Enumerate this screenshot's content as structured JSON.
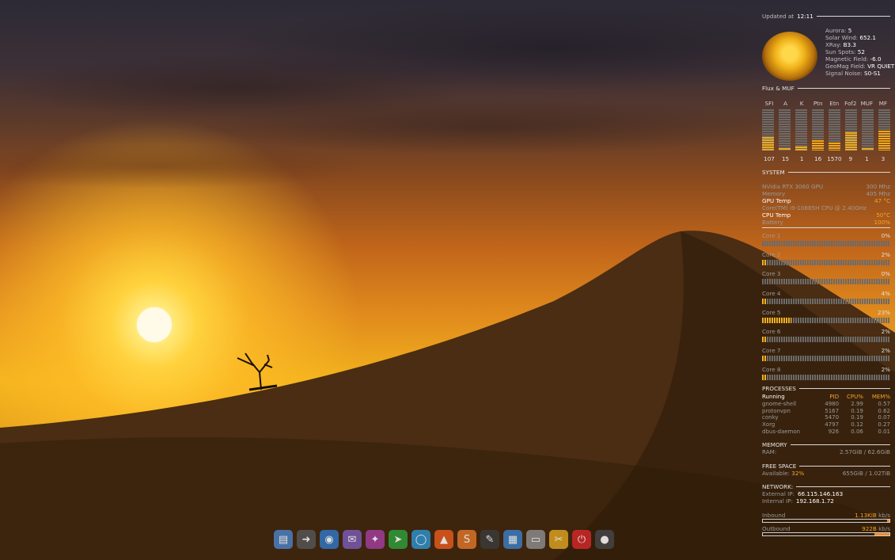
{
  "theme": {
    "accent": "#f0a818",
    "text": "#c9c9c9",
    "highlight": "#ffffff",
    "warm": "#f3a32a"
  },
  "header": {
    "updated_label": "Updated at",
    "updated_time": "12:11"
  },
  "space_weather": [
    {
      "key": "Aurora:",
      "value": "5"
    },
    {
      "key": "Solar Wind:",
      "value": "652.1"
    },
    {
      "key": "XRay:",
      "value": "B3.3"
    },
    {
      "key": "Sun Spots:",
      "value": "52"
    },
    {
      "key": "Magnetic Field:",
      "value": "-6.0"
    },
    {
      "key": "GeoMag Field:",
      "value": "VR QUIET"
    },
    {
      "key": "Signal Noise:",
      "value": "S0-S1"
    }
  ],
  "flux": {
    "title": "Flux & MUF",
    "labels": [
      "SFI",
      "A",
      "K",
      "Ptn",
      "Etn",
      "Fof2",
      "MUF",
      "MF"
    ],
    "values": [
      "107",
      "15",
      "1",
      "16",
      "1570",
      "9",
      "1",
      "3"
    ],
    "fill_levels": [
      0.32,
      0.06,
      0.1,
      0.25,
      0.2,
      0.45,
      0.06,
      0.48
    ]
  },
  "system": {
    "title": "SYSTEM",
    "gpu_name": "NVidia RTX 3060 GPU",
    "gpu_clock": "300 Mhz",
    "memory_label": "Memory",
    "memory_clock": "405 Mhz",
    "gpu_temp_label": "GPU Temp",
    "gpu_temp": "47 °C",
    "cpu_name": "Core(TM) i9-10885H CPU @ 2.40GHz",
    "cpu_temp_label": "CPU Temp",
    "cpu_temp": "50°C",
    "battery_label": "Battery",
    "battery": "100%"
  },
  "cores": [
    {
      "label": "Core 1",
      "pct_text": "0%",
      "pct": 0
    },
    {
      "label": "Core 2",
      "pct_text": "2%",
      "pct": 2
    },
    {
      "label": "Core 3",
      "pct_text": "0%",
      "pct": 0
    },
    {
      "label": "Core 4",
      "pct_text": "4%",
      "pct": 4
    },
    {
      "label": "Core 5",
      "pct_text": "23%",
      "pct": 23
    },
    {
      "label": "Core 6",
      "pct_text": "2%",
      "pct": 2
    },
    {
      "label": "Core 7",
      "pct_text": "2%",
      "pct": 2
    },
    {
      "label": "Core 8",
      "pct_text": "2%",
      "pct": 2
    }
  ],
  "processes": {
    "title": "PROCESSES",
    "columns": [
      "Running",
      "PID",
      "CPU%",
      "MEM%"
    ],
    "rows": [
      [
        "gnome-shell",
        "4980",
        "2.99",
        "0.57"
      ],
      [
        "protonvpn",
        "5167",
        "0.19",
        "0.62"
      ],
      [
        "conky",
        "5470",
        "0.19",
        "0.07"
      ],
      [
        "Xorg",
        "4797",
        "0.12",
        "0.27"
      ],
      [
        "dbus-daemon",
        "926",
        "0.06",
        "0.01"
      ]
    ]
  },
  "memory": {
    "title": "MEMORY",
    "label": "RAM:",
    "value": "2.57GiB  /  62.6GiB"
  },
  "free_space": {
    "title": "FREE SPACE",
    "label": "Available:",
    "percent": "32%",
    "value": "655GiB  /  1.02TiB"
  },
  "network": {
    "title": "NETWORK:",
    "external_label": "External IP:",
    "external_ip": "66.115.146.163",
    "internal_label": "Internal IP:",
    "internal_ip": "192.168.1.72",
    "inbound_label": "Inbound",
    "inbound_value": "1.13KiB",
    "inbound_unit": "kb/s",
    "inbound_level": 0.02,
    "outbound_label": "Outbound",
    "outbound_value": "922B",
    "outbound_unit": "kb/s",
    "outbound_level": 0.12
  },
  "dock": [
    {
      "name": "files-icon",
      "glyph": "▤",
      "color": "#4a7fc1"
    },
    {
      "name": "arrow-icon",
      "glyph": "➜",
      "color": "#555555"
    },
    {
      "name": "browser-icon",
      "glyph": "◉",
      "color": "#2f74c0"
    },
    {
      "name": "mail-icon",
      "glyph": "✉",
      "color": "#7a5ab0"
    },
    {
      "name": "lightbulb-icon",
      "glyph": "✦",
      "color": "#a03d9a"
    },
    {
      "name": "telegram-icon",
      "glyph": "➤",
      "color": "#2e9b3a"
    },
    {
      "name": "chat-icon",
      "glyph": "◯",
      "color": "#2c8fc9"
    },
    {
      "name": "brave-icon",
      "glyph": "▲",
      "color": "#e0581e"
    },
    {
      "name": "sublime-icon",
      "glyph": "S",
      "color": "#d9732a"
    },
    {
      "name": "editor-icon",
      "glyph": "✎",
      "color": "#3a3a3a"
    },
    {
      "name": "document-icon",
      "glyph": "▦",
      "color": "#3a7cc0"
    },
    {
      "name": "window-icon",
      "glyph": "▭",
      "color": "#8a8a8a"
    },
    {
      "name": "cleaner-icon",
      "glyph": "✂",
      "color": "#d8a020"
    },
    {
      "name": "power-icon",
      "glyph": "⏻",
      "color": "#d02828"
    },
    {
      "name": "disc-icon",
      "glyph": "●",
      "color": "#444444"
    }
  ]
}
